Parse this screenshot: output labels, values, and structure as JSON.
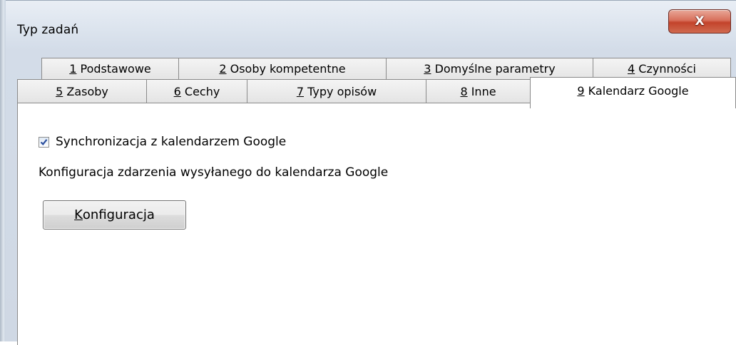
{
  "window": {
    "title": "Typ zadań",
    "close_label": "X"
  },
  "tabs": {
    "row1": [
      {
        "num": "1",
        "label": " Podstawowe"
      },
      {
        "num": "2",
        "label": " Osoby kompetentne"
      },
      {
        "num": "3",
        "label": " Domyślne parametry"
      },
      {
        "num": "4",
        "label": " Czynności"
      }
    ],
    "row2": [
      {
        "num": "5",
        "label": " Zasoby"
      },
      {
        "num": "6",
        "label": " Cechy"
      },
      {
        "num": "7",
        "label": " Typy opisów"
      },
      {
        "num": "8",
        "label": " Inne"
      },
      {
        "num": "9",
        "label": " Kalendarz Google"
      }
    ],
    "active": "9"
  },
  "panel": {
    "sync_checkbox": {
      "label": "Synchronizacja z kalendarzem Google",
      "checked": true
    },
    "description": "Konfiguracja zdarzenia wysyłanego do kalendarza Google",
    "config_button": {
      "accel": "K",
      "rest": "onfiguracja"
    }
  },
  "colors": {
    "close_button": "#c3432b",
    "checkmark": "#2c4f9e"
  }
}
